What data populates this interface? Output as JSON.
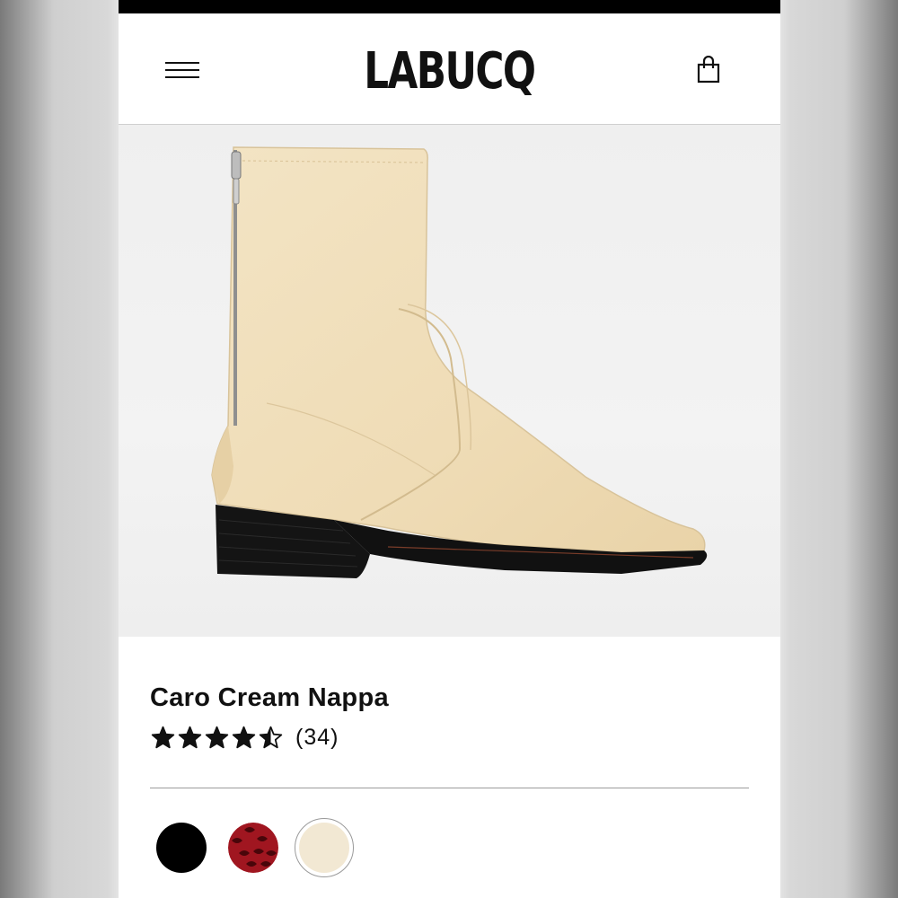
{
  "header": {
    "brand": "LABUCQ",
    "menu_icon": "hamburger-menu-icon",
    "cart_icon": "shopping-bag-icon"
  },
  "gallery": {
    "image": "cream-leather-ankle-boot-side-view",
    "slide_count": 8,
    "active_slide": 1
  },
  "product": {
    "name": "Caro Cream Nappa",
    "rating": 4.5,
    "rating_max": 5,
    "review_count": "(34)"
  },
  "colors": {
    "options": [
      {
        "name": "black",
        "hex": "#000000"
      },
      {
        "name": "red-snake",
        "hex": "#a01620"
      },
      {
        "name": "cream",
        "hex": "#f2e8d3",
        "selected": true
      }
    ]
  },
  "theme": {
    "boot_color": "#f0e0bf",
    "sole_color": "#111111"
  }
}
